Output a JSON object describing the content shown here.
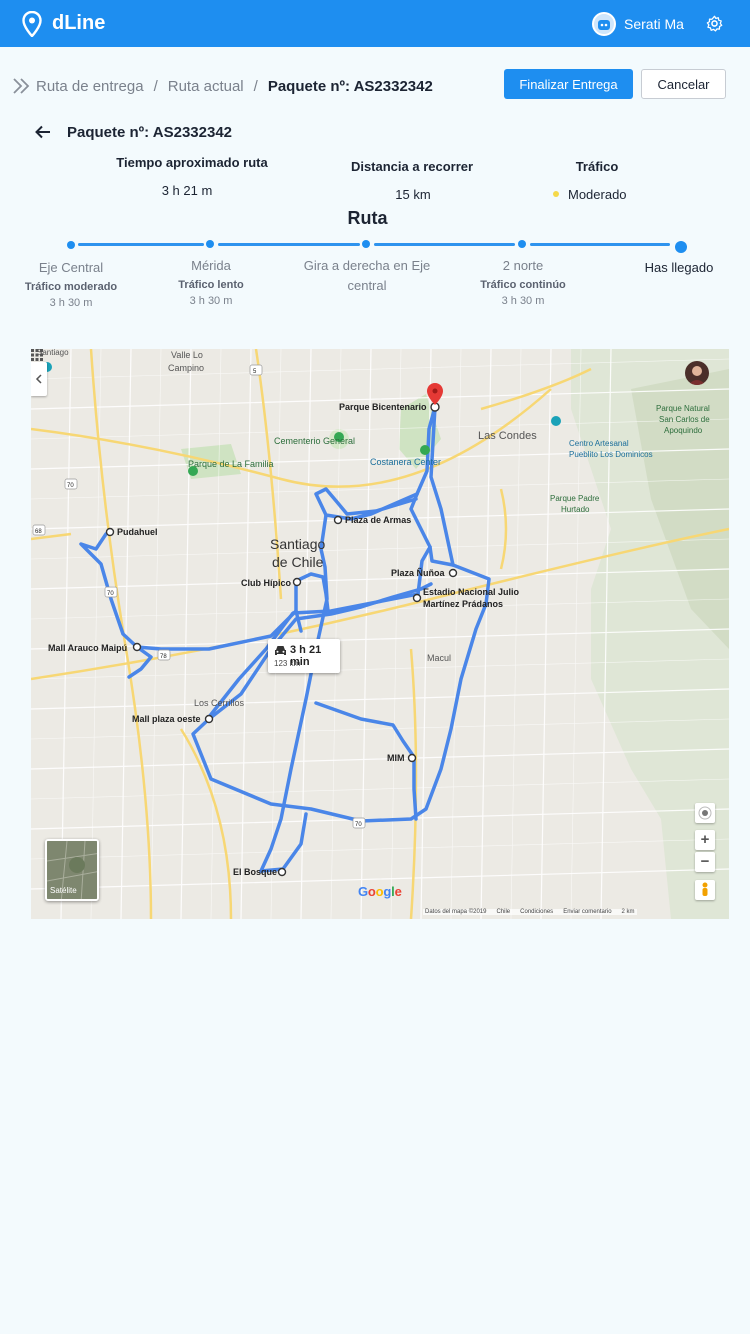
{
  "app": {
    "name": "dLine"
  },
  "user": {
    "name": "Serati Ma"
  },
  "breadcrumb": {
    "items": [
      "Ruta de entrega",
      "Ruta actual"
    ],
    "current": "Paquete nº: AS2332342"
  },
  "actions": {
    "finish": "Finalizar Entrega",
    "cancel": "Cancelar"
  },
  "package": {
    "title": "Paquete nº: AS2332342"
  },
  "stats": {
    "time": {
      "label": "Tiempo aproximado ruta",
      "value": "3 h 21 m"
    },
    "distance": {
      "label": "Distancia a recorrer",
      "value": "15 km"
    },
    "traffic": {
      "label": "Tráfico",
      "value": "Moderado"
    }
  },
  "route": {
    "title": "Ruta",
    "steps": [
      {
        "name": "Eje Central",
        "traffic": "Tráfico moderado",
        "time": "3 h 30 m"
      },
      {
        "name": "Mérida",
        "traffic": "Tráfico lento",
        "time": "3 h 30 m"
      },
      {
        "name": "Gira a derecha en Eje central",
        "traffic": "",
        "time": ""
      },
      {
        "name": "2 norte",
        "traffic": "Tráfico continúo",
        "time": "3 h 30 m"
      },
      {
        "name": "Has llegado",
        "traffic": "",
        "time": ""
      }
    ]
  },
  "map": {
    "city": [
      "Santiago",
      "de Chile"
    ],
    "places": {
      "valle": [
        "Valle Lo",
        "Campino"
      ],
      "cementerio": "Cementerio General",
      "familia": "Parque de La Familia",
      "costanera": "Costanera Center",
      "condes": "Las Condes",
      "centroArtesanal": [
        "Centro Artesanal",
        "Pueblito Los Dominicos"
      ],
      "parqueNatural": [
        "Parque Natural",
        "San Carlos de",
        "Apoquindo"
      ],
      "padreHurtado": [
        "Parque Padre",
        "Hurtado"
      ],
      "macul": "Macul",
      "cerrillos": "Los Cerrillos",
      "santiagoTop": "Santiago"
    },
    "stops": {
      "bicentenario": "Parque Bicentenario",
      "pudahuel": "Pudahuel",
      "plazaArmas": "Plaza de Armas",
      "clubHipico": "Club Hípico",
      "plazaNunoa": "Plaza Ñuñoa",
      "estadio": [
        "Estadio Nacional Julio",
        "Martínez Prádanos"
      ],
      "maipu": "Mall Arauco Maipú",
      "plazaOeste": "Mall plaza oeste",
      "mim": "MIM",
      "bosque": "El Bosque"
    },
    "routeCard": {
      "time": "3 h 21 min",
      "distance": "123 km"
    },
    "satelliteLabel": "Satélite",
    "google": "Google",
    "footer": [
      "Datos del mapa ©2019",
      "Chile",
      "Condiciones",
      "Enviar comentario",
      "2 km"
    ],
    "roadLabels": {
      "r1": "70",
      "r2": "5",
      "r3": "78",
      "r4": "68"
    }
  },
  "colors": {
    "primary": "#1e8ef0",
    "route": "#4a86e8",
    "traffic": "#f5d94a"
  }
}
